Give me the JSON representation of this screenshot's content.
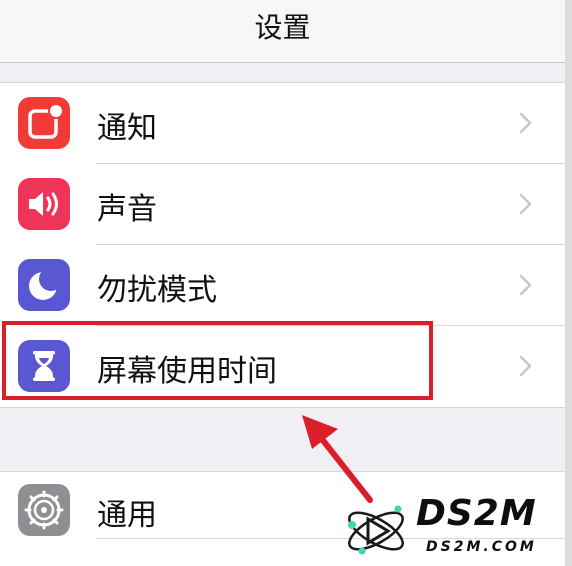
{
  "header": {
    "title": "设置"
  },
  "group1": [
    {
      "label": "通知",
      "icon": "notifications-icon",
      "color": "#f23b36"
    },
    {
      "label": "声音",
      "icon": "sound-icon",
      "color": "#f03458"
    },
    {
      "label": "勿扰模式",
      "icon": "moon-icon",
      "color": "#5a57d2"
    },
    {
      "label": "屏幕使用时间",
      "icon": "hourglass-icon",
      "color": "#5a57d2"
    }
  ],
  "group2": [
    {
      "label": "通用",
      "icon": "gear-icon",
      "color": "#8e8e93"
    }
  ],
  "annotation": {
    "highlight_color": "#d9202a"
  },
  "watermark": {
    "brand": "DS2M",
    "site": "DS2M.COM"
  }
}
